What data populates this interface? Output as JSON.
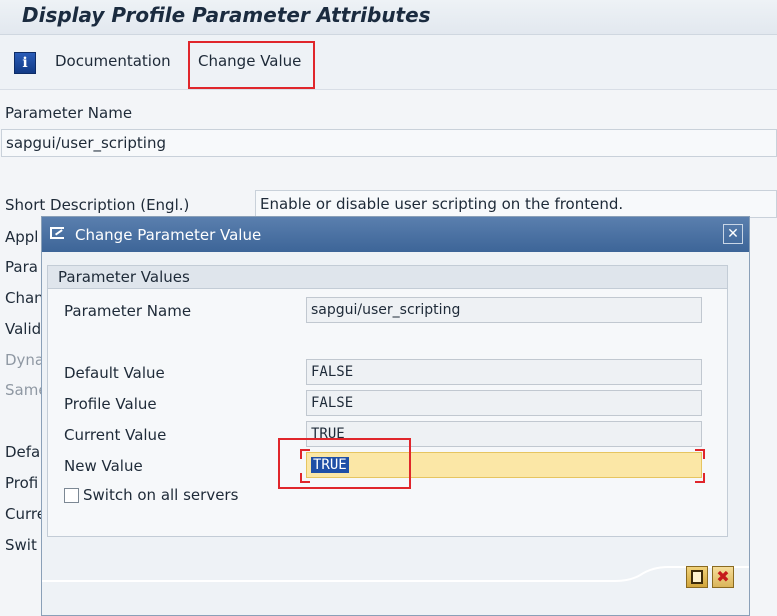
{
  "window": {
    "title": "Display Profile Parameter Attributes"
  },
  "toolbar": {
    "info_icon": "info-icon",
    "info_glyph": "i",
    "documentation_label": "Documentation",
    "change_value_label": "Change Value"
  },
  "background": {
    "param_name_label": "Parameter Name",
    "param_name_value": "sapgui/user_scripting",
    "short_desc_label": "Short Description (Engl.)",
    "short_desc_value": "Enable or disable user scripting on the frontend.",
    "clipped_labels": [
      "Appl",
      "Para",
      "Chan",
      "Valid",
      "Dyna",
      "Same",
      "Defa",
      "Profi",
      "Curre",
      "Swit"
    ]
  },
  "dialog": {
    "title": "Change Parameter Value",
    "close_glyph": "✕",
    "group_title": "Parameter Values",
    "rows": {
      "parameter_name": {
        "label": "Parameter Name",
        "value": "sapgui/user_scripting"
      },
      "default_value": {
        "label": "Default Value",
        "value": "FALSE"
      },
      "profile_value": {
        "label": "Profile Value",
        "value": "FALSE"
      },
      "current_value": {
        "label": "Current Value",
        "value": "TRUE"
      },
      "new_value": {
        "label": "New Value",
        "value": "TRUE"
      }
    },
    "switch_all_label": "Switch on all servers",
    "switch_all_checked": false,
    "cancel_glyph": "✖"
  },
  "colors": {
    "highlight_box": "#e0262b",
    "dialog_header": "#4a71a3",
    "input_field": "#fbe7a6"
  }
}
